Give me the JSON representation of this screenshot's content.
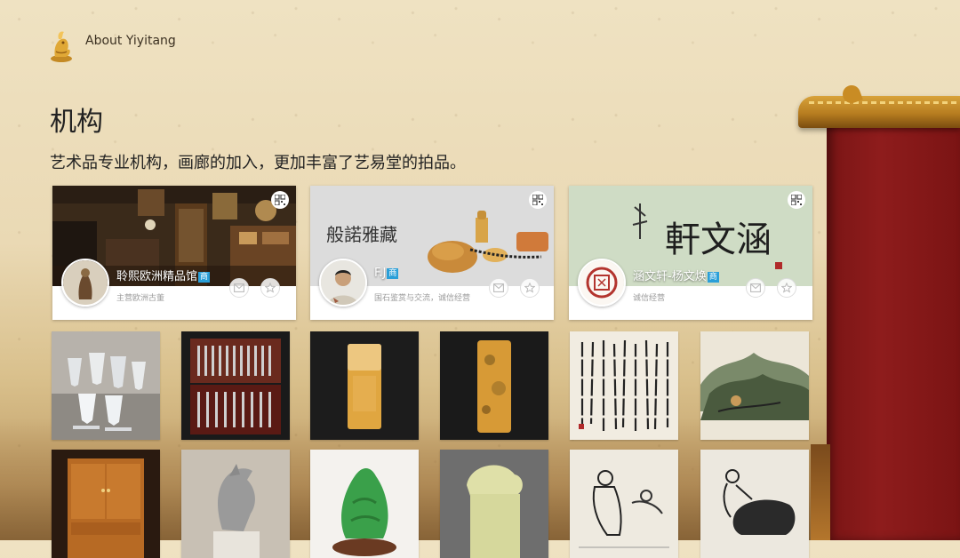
{
  "header": {
    "app_title": "About Yiyitang"
  },
  "page": {
    "title": "机构",
    "subtitle": "艺术品专业机构，画廊的加入，更加丰富了艺易堂的拍品。"
  },
  "shops": [
    {
      "name": "聆熙欧洲精品馆",
      "badge": "商",
      "desc": "主营欧洲古董",
      "icons": [
        "qr-code-icon",
        "message-icon",
        "star-icon"
      ]
    },
    {
      "name": "F.J",
      "badge": "商",
      "desc": "国石鉴赏与交流，诚信经营",
      "banner_text": "般諾雅藏",
      "icons": [
        "qr-code-icon",
        "message-icon",
        "star-icon"
      ]
    },
    {
      "name": "涵文轩-杨文焕",
      "badge": "商",
      "desc": "诚信经营",
      "banner_text": "軒文涵",
      "icons": [
        "qr-code-icon",
        "message-icon",
        "star-icon"
      ]
    }
  ],
  "products": [
    {
      "subject": "crystal-glasses"
    },
    {
      "subject": "silverware-set"
    },
    {
      "subject": "yellow-stone-seal"
    },
    {
      "subject": "mottled-stone-seal"
    },
    {
      "subject": "calligraphy-scroll"
    },
    {
      "subject": "landscape-painting"
    },
    {
      "subject": "wooden-cabinet"
    },
    {
      "subject": "horse-head-sculpture"
    },
    {
      "subject": "jade-carving"
    },
    {
      "subject": "jade-beast-seal"
    },
    {
      "subject": "figure-painting"
    },
    {
      "subject": "ox-herder-painting"
    }
  ],
  "colors": {
    "badge_blue": "#2a9fd8",
    "wall_red": "#8e1c1c",
    "roof_gold": "#d8a23a"
  }
}
